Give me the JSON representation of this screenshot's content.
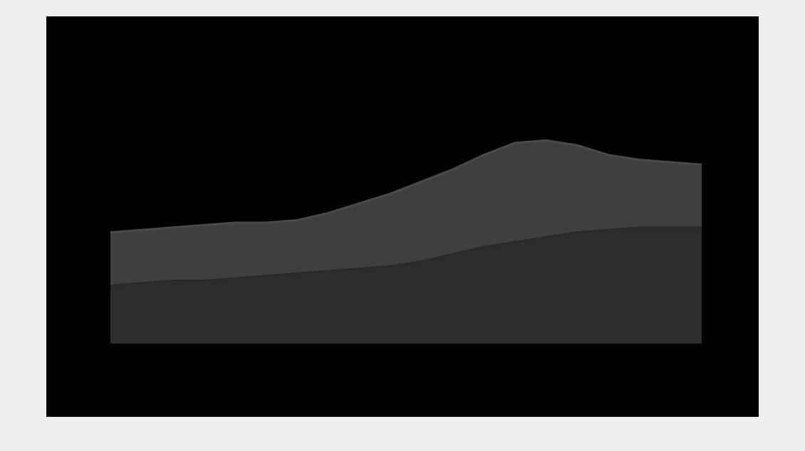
{
  "card": {
    "bg_color": "#000000",
    "page_bg_color": "#efefef",
    "source": "",
    "brand": ""
  },
  "chart_data": {
    "type": "area",
    "title": "",
    "subtitle": "",
    "xlabel": "",
    "ylabel": "",
    "x": [
      1,
      2,
      3,
      4,
      5,
      6,
      7,
      8,
      9,
      10,
      11,
      12,
      13,
      14,
      15,
      16,
      17,
      18,
      19,
      20
    ],
    "x_tick_labels": [
      "",
      "",
      "",
      ""
    ],
    "x_tick_positions": [
      4,
      8.5,
      14,
      18
    ],
    "ylim": [
      0,
      5
    ],
    "y_ticks": [
      0,
      1,
      2,
      3,
      4,
      5
    ],
    "y_tick_labels": [
      "",
      "",
      "",
      "",
      "",
      ""
    ],
    "y2_tick_labels": [
      "",
      "",
      "",
      "",
      "",
      ""
    ],
    "series": [
      {
        "name": "",
        "color": "#4a4a4a",
        "values": [
          2.3,
          2.35,
          2.4,
          2.45,
          2.5,
          2.5,
          2.55,
          2.7,
          2.9,
          3.1,
          3.35,
          3.6,
          3.9,
          4.15,
          4.2,
          4.1,
          3.9,
          3.8,
          3.75,
          3.7
        ]
      },
      {
        "name": "",
        "color": "#2a2a2a",
        "values": [
          1.2,
          1.25,
          1.3,
          1.3,
          1.35,
          1.4,
          1.45,
          1.5,
          1.55,
          1.6,
          1.7,
          1.85,
          2.0,
          2.1,
          2.2,
          2.3,
          2.35,
          2.4,
          2.4,
          2.4
        ]
      }
    ],
    "legend": {
      "title": "",
      "placement": "top-right",
      "entries": []
    },
    "grid": false
  }
}
